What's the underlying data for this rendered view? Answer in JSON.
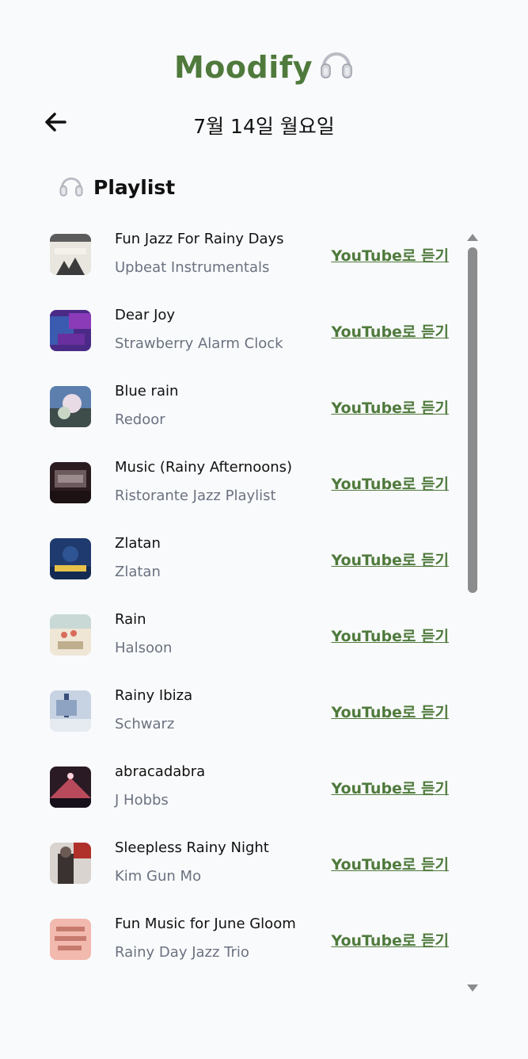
{
  "app": {
    "title": "Moodify",
    "icon": "headphones-icon"
  },
  "header": {
    "back_icon": "arrow-left-icon",
    "date": "7월 14일 월요일"
  },
  "section": {
    "icon": "headphones-icon",
    "title": "Playlist"
  },
  "playlist": [
    {
      "title": "Fun Jazz For Rainy Days",
      "artist": "Upbeat Instrumentals",
      "link": "YouTube로 듣기"
    },
    {
      "title": "Dear Joy",
      "artist": "Strawberry Alarm Clock",
      "link": "YouTube로 듣기"
    },
    {
      "title": "Blue rain",
      "artist": "Redoor",
      "link": "YouTube로 듣기"
    },
    {
      "title": "Music (Rainy Afternoons)",
      "artist": "Ristorante Jazz Playlist",
      "link": "YouTube로 듣기"
    },
    {
      "title": "Zlatan",
      "artist": "Zlatan",
      "link": "YouTube로 듣기"
    },
    {
      "title": "Rain",
      "artist": "Halsoon",
      "link": "YouTube로 듣기"
    },
    {
      "title": "Rainy Ibiza",
      "artist": "Schwarz",
      "link": "YouTube로 듣기"
    },
    {
      "title": "abracadabra",
      "artist": "J Hobbs",
      "link": "YouTube로 듣기"
    },
    {
      "title": "Sleepless Rainy Night",
      "artist": "Kim Gun Mo",
      "link": "YouTube로 듣기"
    },
    {
      "title": "Fun Music for June Gloom",
      "artist": "Rainy Day Jazz Trio",
      "link": "YouTube로 듣기"
    }
  ],
  "colors": {
    "accent": "#4f7a3c",
    "background": "#f9fafc",
    "secondary_text": "#6b7280",
    "scrollbar": "#8c8c8c"
  }
}
